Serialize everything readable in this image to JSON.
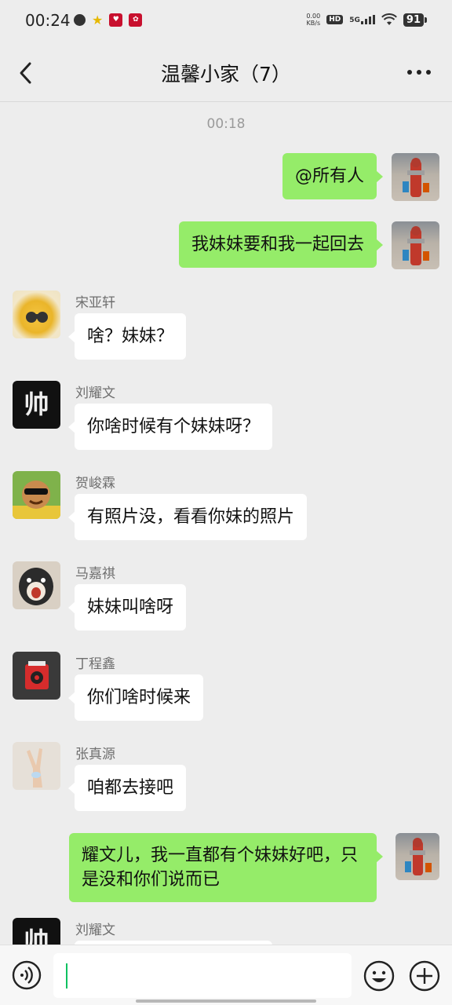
{
  "status_bar": {
    "time": "00:24",
    "net_speed_value": "0.00",
    "net_speed_unit": "KB/s",
    "hd_label": "HD",
    "network_label": "5G",
    "battery": "91"
  },
  "header": {
    "title": "温馨小家（7）"
  },
  "chat": {
    "timestamp": "00:18",
    "messages": [
      {
        "side": "right",
        "text": "@所有人"
      },
      {
        "side": "right",
        "text": "我妹妹要和我一起回去"
      },
      {
        "side": "left",
        "sender": "宋亚轩",
        "text": "啥？妹妹？"
      },
      {
        "side": "left",
        "sender": "刘耀文",
        "text": "你啥时候有个妹妹呀？",
        "avatar_text": "帅"
      },
      {
        "side": "left",
        "sender": "贺峻霖",
        "text": "有照片没，看看你妹的照片"
      },
      {
        "side": "left",
        "sender": "马嘉祺",
        "text": "妹妹叫啥呀"
      },
      {
        "side": "left",
        "sender": "丁程鑫",
        "text": "你们啥时候来"
      },
      {
        "side": "left",
        "sender": "张真源",
        "text": "咱都去接吧"
      },
      {
        "side": "right",
        "text": "耀文儿，我一直都有个妹妹好吧，只是没和你们说而已"
      },
      {
        "side": "left",
        "sender": "刘耀文",
        "text": "",
        "avatar_text": "帅"
      }
    ]
  },
  "input_bar": {
    "value": "",
    "placeholder": ""
  },
  "colors": {
    "background": "#ededed",
    "self_bubble": "#95ec69",
    "other_bubble": "#ffffff",
    "caret": "#07c160"
  }
}
